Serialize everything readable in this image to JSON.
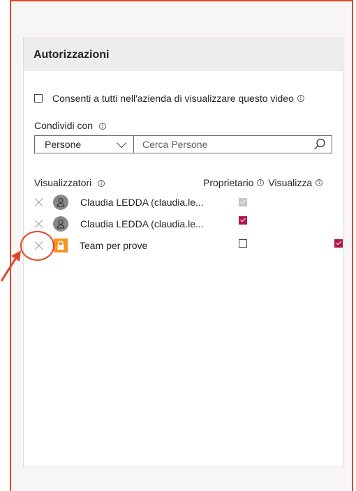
{
  "panel": {
    "title": "Autorizzazioni",
    "allow_all_label": "Consenti a tutti nell'azienda di visualizzare questo video",
    "share_with_label": "Condividi con",
    "share_type_value": "Persone",
    "search_placeholder": "Cerca Persone",
    "viewers_heading": "Visualizzatori",
    "col_owner": "Proprietario",
    "col_view": "Visualizza",
    "info_glyph": "i"
  },
  "viewers": [
    {
      "name": "Claudia LEDDA (claudia.le...",
      "type": "user",
      "owner": "checked-disabled",
      "view": "none"
    },
    {
      "name": "Claudia LEDDA (claudia.le...",
      "type": "user",
      "owner": "checked",
      "view": "none"
    },
    {
      "name": "Team per prove",
      "type": "group",
      "owner": "unchecked",
      "view": "checked"
    }
  ],
  "colors": {
    "accent": "#b4154a",
    "group_icon": "#f7941d",
    "annotation": "#e0462b"
  },
  "icons": [
    "info-icon",
    "chevron-down-icon",
    "search-icon",
    "remove-icon",
    "person-icon",
    "lock-icon"
  ]
}
